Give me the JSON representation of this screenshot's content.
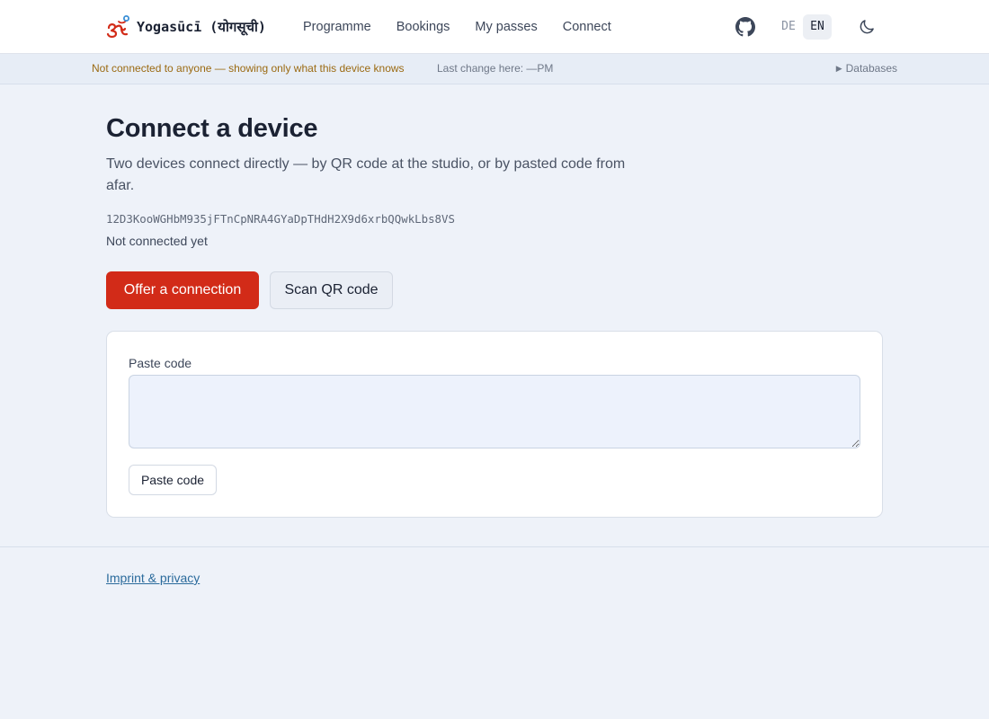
{
  "app": {
    "brand_name": "Yogasūcī (योगसूची)",
    "logo_icon": "om-icon",
    "brand_color": "#d22b18"
  },
  "nav": {
    "items": [
      {
        "label": "Programme"
      },
      {
        "label": "Bookings"
      },
      {
        "label": "My passes"
      },
      {
        "label": "Connect"
      }
    ],
    "github_icon": "github-icon",
    "languages": [
      {
        "label": "DE",
        "active": false
      },
      {
        "label": "EN",
        "active": true
      }
    ],
    "theme_icon": "moon-icon"
  },
  "status": {
    "warning": "Not connected to anyone — showing only what this device knows",
    "last_change": "Last change here: —PM",
    "databases_label": "Databases",
    "databases_icon": "triangle-right-icon",
    "warning_color": "#9b6a12"
  },
  "main": {
    "title": "Connect a device",
    "subtitle": "Two devices connect directly — by QR code at the studio, or by pasted code from afar.",
    "peer_id": "12D3KooWGHbM935jFTnCpNRA4GYaDpTHdH2X9d6xrbQQwkLbs8VS",
    "connection_status": "Not connected yet",
    "offer_button": "Offer a connection",
    "scan_button": "Scan QR code",
    "paste_card": {
      "label": "Paste code",
      "textarea_value": "",
      "textarea_placeholder": "",
      "button": "Paste code"
    }
  },
  "footer": {
    "link": "Imprint & privacy"
  }
}
